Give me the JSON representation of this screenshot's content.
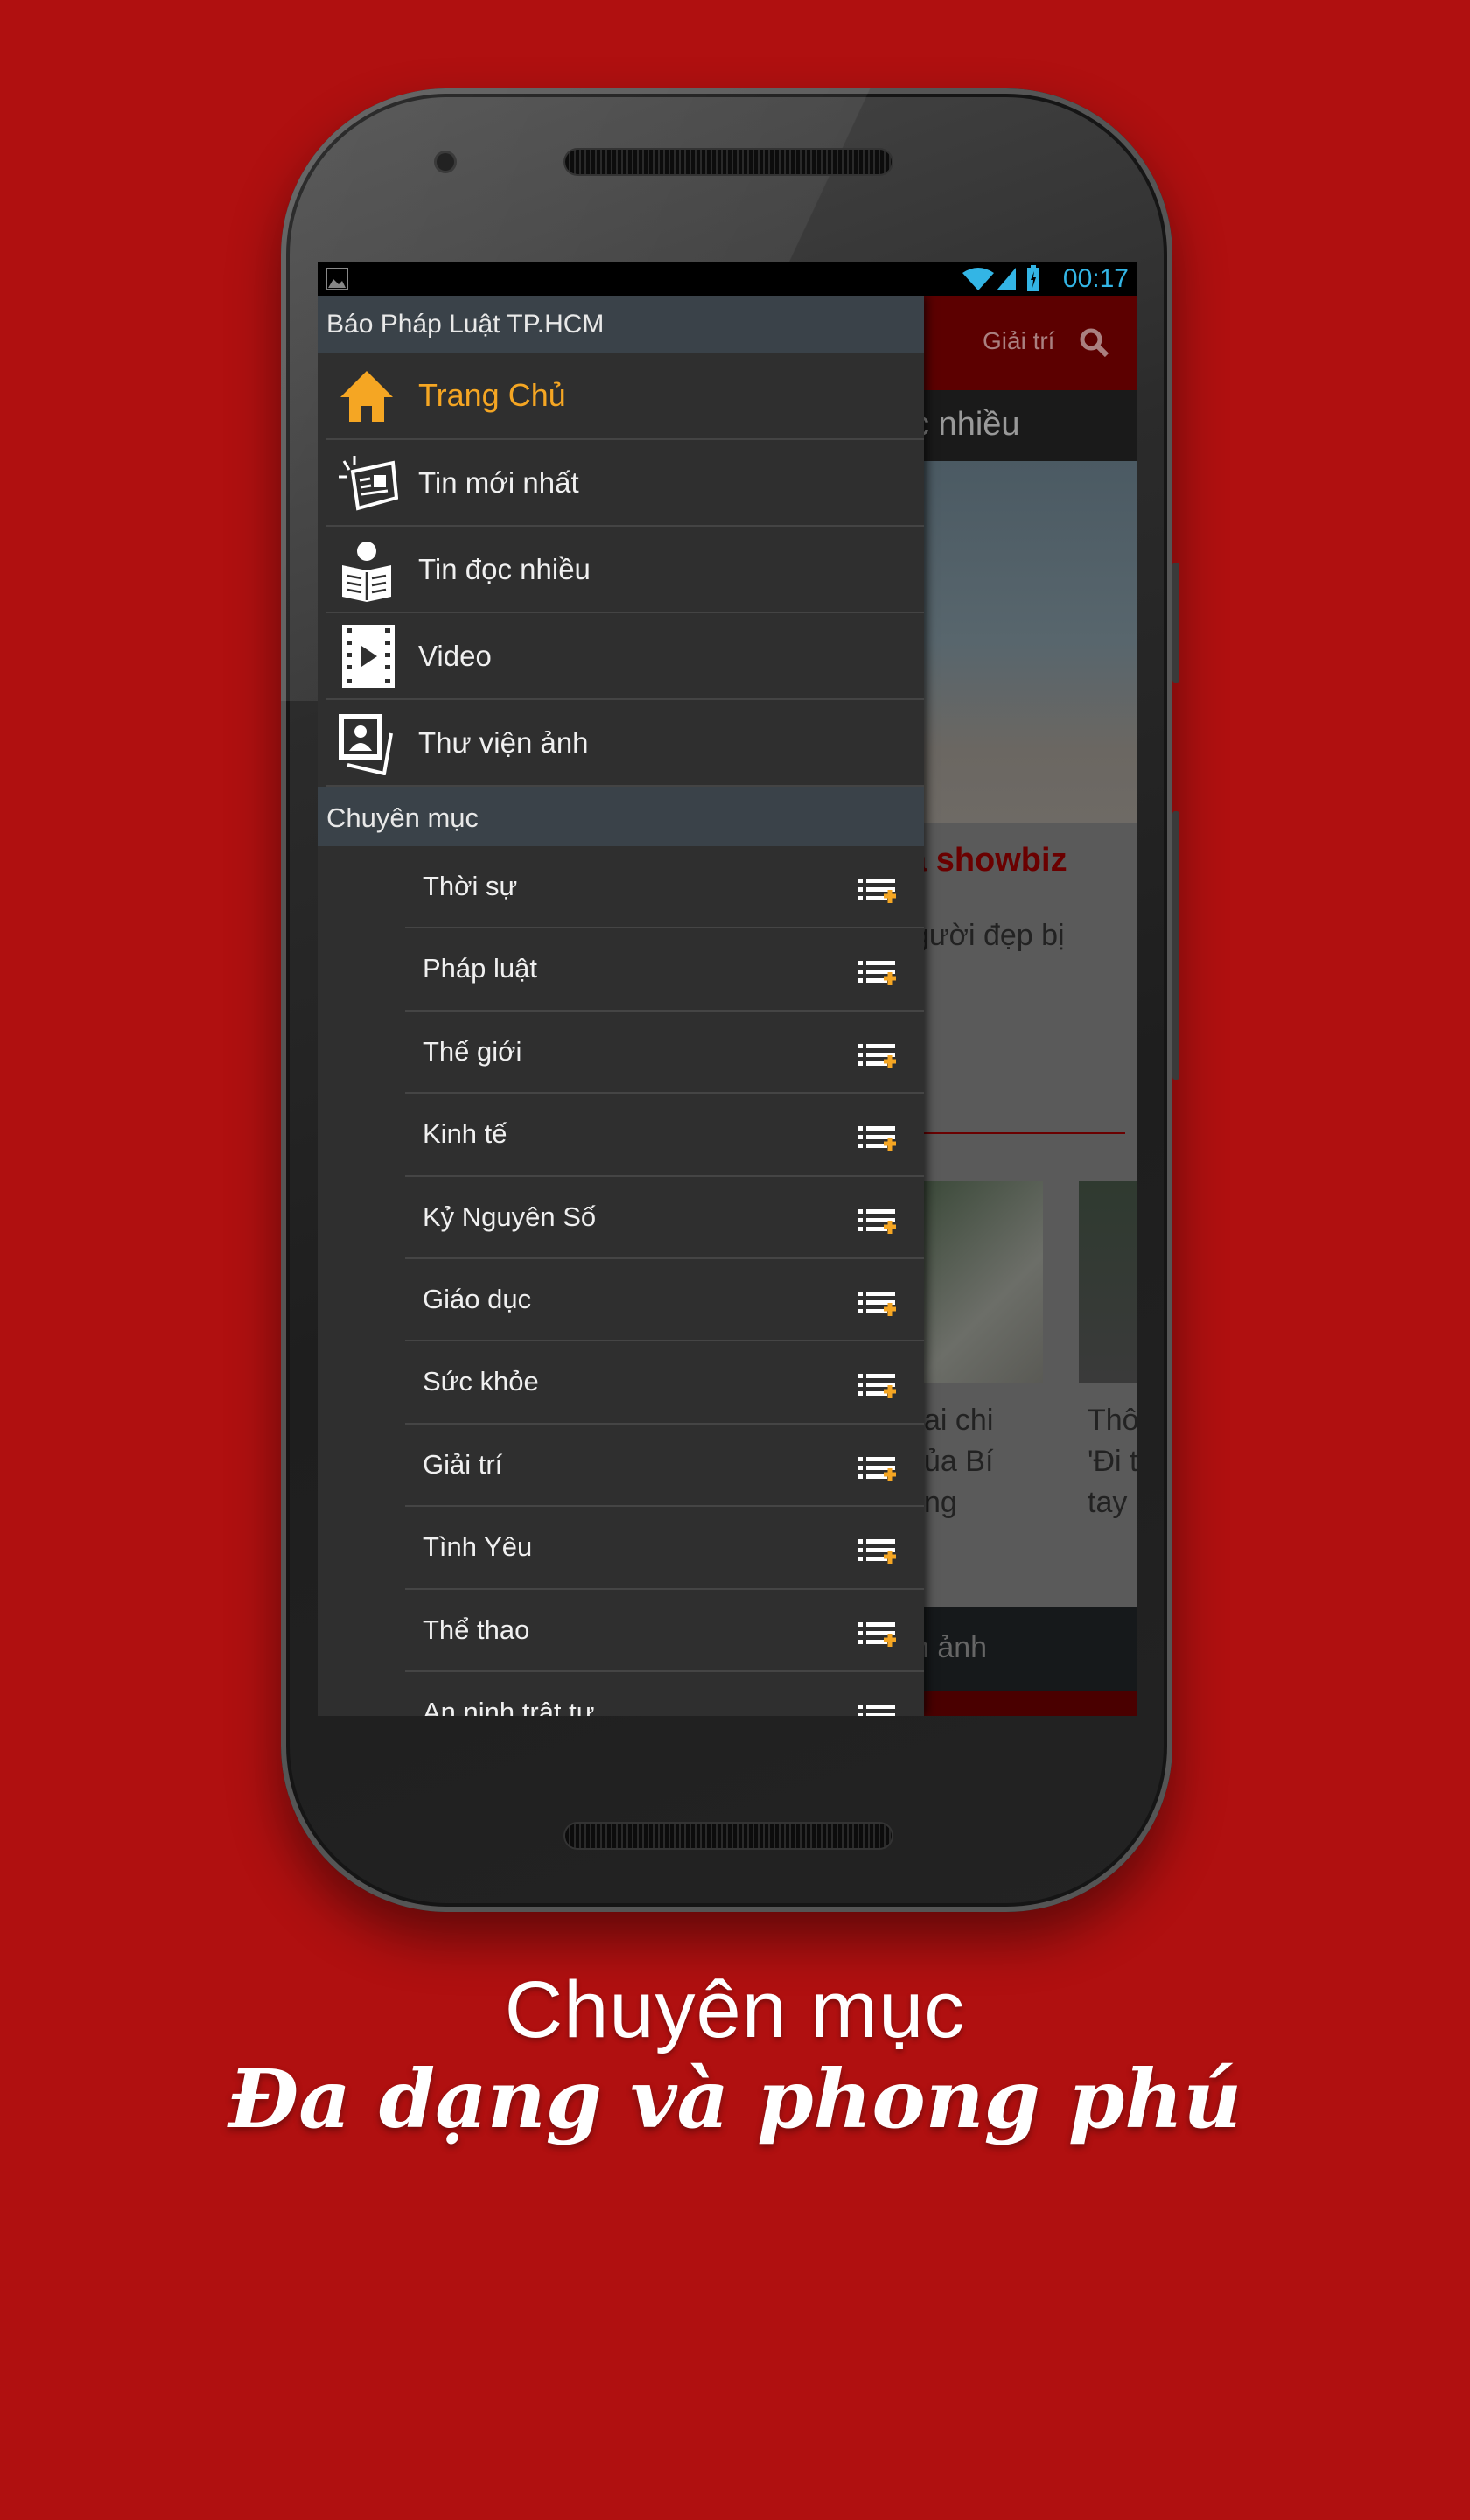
{
  "colors": {
    "background": "#b01010",
    "accent": "#f5a623",
    "drawer": "#2f2f2f",
    "drawer_header": "#3a4249",
    "status_text": "#33b5e5"
  },
  "status_bar": {
    "time": "00:17",
    "icons": [
      "image-notification-icon",
      "wifi-icon",
      "signal-icon",
      "battery-charging-icon"
    ]
  },
  "behind": {
    "category": "Giải trí",
    "tab": "c nhiều",
    "headline": "a showbiz",
    "subtitle": "gười đẹp bị",
    "caption1": "ai chi\nủa Bí\nng",
    "caption2": "Thô\n'Đi t\ntay",
    "bottom_tab": "n ảnh"
  },
  "drawer": {
    "title": "Báo Pháp Luật TP.HCM",
    "items": [
      {
        "label": "Trang Chủ",
        "icon": "home-icon",
        "active": true
      },
      {
        "label": "Tin mới nhất",
        "icon": "newspaper-icon"
      },
      {
        "label": "Tin đọc nhiều",
        "icon": "reader-icon"
      },
      {
        "label": "Video",
        "icon": "film-icon"
      },
      {
        "label": "Thư viện ảnh",
        "icon": "photo-gallery-icon"
      }
    ],
    "section": "Chuyên mục",
    "categories": [
      {
        "label": "Thời sự"
      },
      {
        "label": "Pháp luật"
      },
      {
        "label": "Thế giới"
      },
      {
        "label": "Kinh tế"
      },
      {
        "label": "Kỷ Nguyên Số"
      },
      {
        "label": "Giáo dục"
      },
      {
        "label": "Sức khỏe"
      },
      {
        "label": "Giải trí"
      },
      {
        "label": "Tình Yêu"
      },
      {
        "label": "Thể thao"
      },
      {
        "label": "An ninh trật tự"
      }
    ]
  },
  "tagline": {
    "line1": "Chuyên mục",
    "line2": "Đa dạng và phong phú"
  }
}
